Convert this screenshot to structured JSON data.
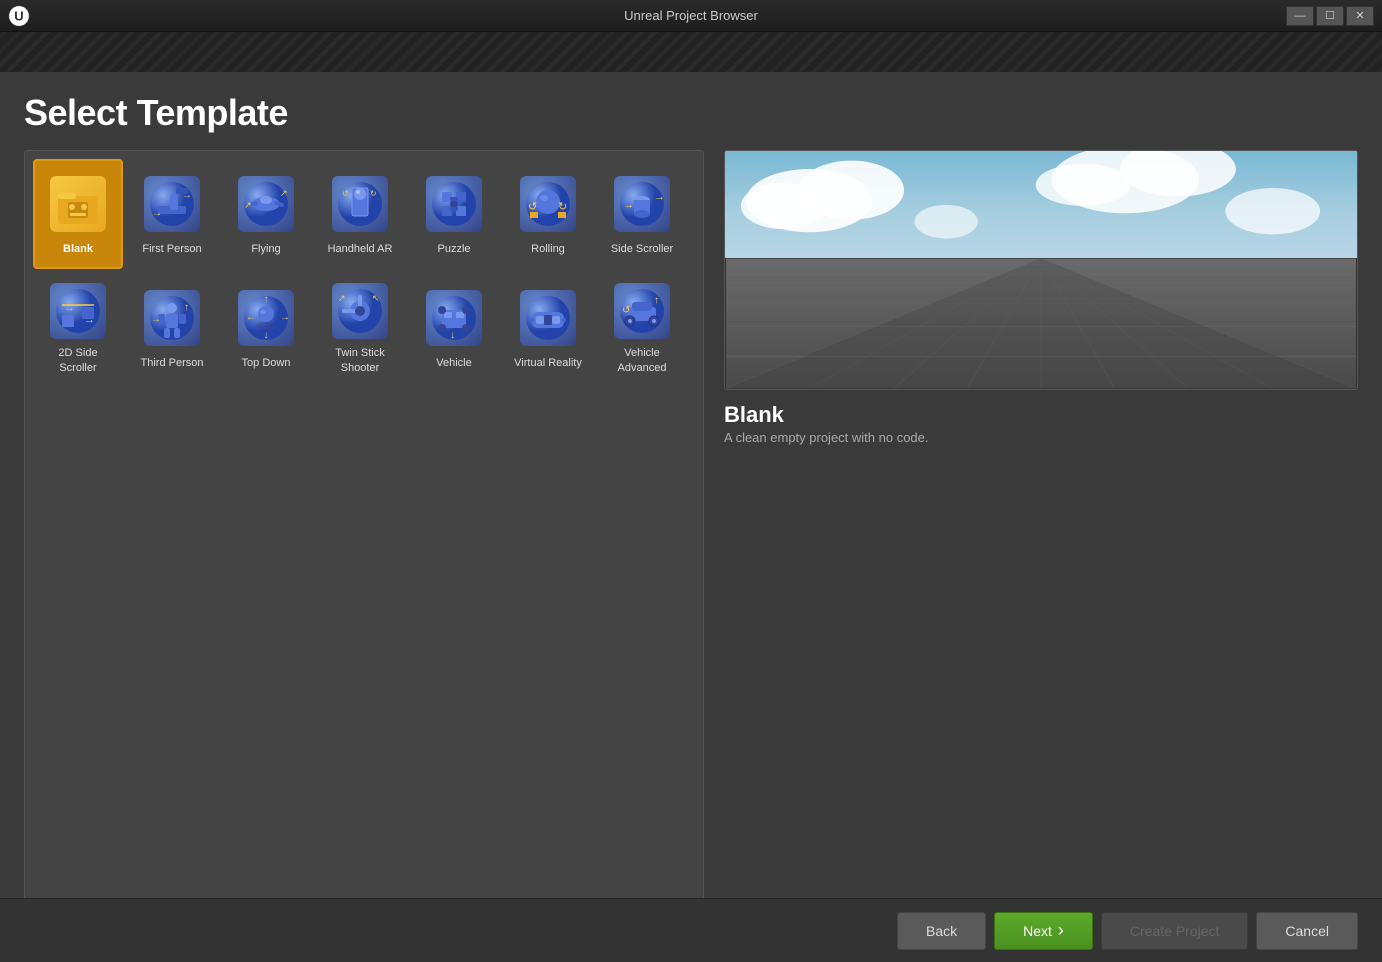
{
  "window": {
    "title": "Unreal Project Browser",
    "controls": {
      "minimize": "—",
      "maximize": "☐",
      "close": "✕"
    }
  },
  "page": {
    "title": "Select Template"
  },
  "templates": [
    {
      "id": "blank",
      "label": "Blank",
      "selected": true,
      "row": 0
    },
    {
      "id": "first-person",
      "label": "First Person",
      "selected": false,
      "row": 0
    },
    {
      "id": "flying",
      "label": "Flying",
      "selected": false,
      "row": 0
    },
    {
      "id": "handheld-ar",
      "label": "Handheld AR",
      "selected": false,
      "row": 0
    },
    {
      "id": "puzzle",
      "label": "Puzzle",
      "selected": false,
      "row": 0
    },
    {
      "id": "rolling",
      "label": "Rolling",
      "selected": false,
      "row": 0
    },
    {
      "id": "side-scroller",
      "label": "Side Scroller",
      "selected": false,
      "row": 0
    },
    {
      "id": "2d-side-scroller",
      "label": "2D Side Scroller",
      "selected": false,
      "row": 1
    },
    {
      "id": "third-person",
      "label": "Third Person",
      "selected": false,
      "row": 1
    },
    {
      "id": "top-down",
      "label": "Top Down",
      "selected": false,
      "row": 1
    },
    {
      "id": "twin-stick-shooter",
      "label": "Twin Stick Shooter",
      "selected": false,
      "row": 1
    },
    {
      "id": "vehicle",
      "label": "Vehicle",
      "selected": false,
      "row": 1
    },
    {
      "id": "virtual-reality",
      "label": "Virtual Reality",
      "selected": false,
      "row": 1
    },
    {
      "id": "vehicle-advanced",
      "label": "Vehicle Advanced",
      "selected": false,
      "row": 1
    }
  ],
  "preview": {
    "title": "Blank",
    "description": "A clean empty project with no code."
  },
  "buttons": {
    "back": "Back",
    "next": "Next",
    "next_arrow": "›",
    "create_project": "Create Project",
    "cancel": "Cancel"
  }
}
